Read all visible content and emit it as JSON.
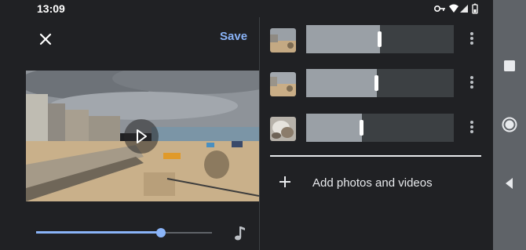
{
  "status_bar": {
    "time": "13:09",
    "icons": [
      "key-icon",
      "wifi-icon",
      "signal-icon",
      "battery-icon"
    ]
  },
  "editor": {
    "close_icon": "close-icon",
    "save_label": "Save",
    "play_icon": "play-icon",
    "playback_progress": 0.71,
    "music_icon": "music-note-icon"
  },
  "clips": [
    {
      "thumb": "beach-scene",
      "trim_fraction": 0.5
    },
    {
      "thumb": "beach-scene",
      "trim_fraction": 0.48
    },
    {
      "thumb": "rocks-scene",
      "trim_fraction": 0.38
    }
  ],
  "add_media": {
    "label": "Add photos and videos",
    "icon": "plus-icon"
  },
  "nav_bar": [
    "recents-icon",
    "home-icon",
    "back-icon"
  ],
  "colors": {
    "background": "#202124",
    "accent": "#8ab4f8",
    "nav_bar": "#5f6368"
  }
}
